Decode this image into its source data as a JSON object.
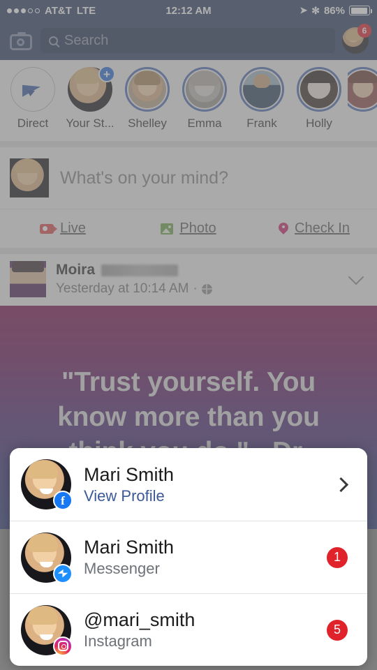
{
  "status_bar": {
    "carrier": "AT&T",
    "network": "LTE",
    "time": "12:12 AM",
    "battery_percent": "86%",
    "signal_dots_filled": 3,
    "signal_dots_total": 5,
    "location_icon": "location-arrow-icon",
    "bluetooth_icon": "bluetooth-icon"
  },
  "nav": {
    "camera_icon": "camera-icon",
    "search_placeholder": "Search",
    "search_value": "",
    "search_icon": "search-icon",
    "profile_badge_count": "6"
  },
  "stories": {
    "items": [
      {
        "label": "Direct",
        "icon": "paper-plane-icon",
        "ring": "plain",
        "has_plus": false
      },
      {
        "label": "Your St...",
        "icon": "",
        "ring": "none",
        "has_plus": true,
        "plus_label": "+"
      },
      {
        "label": "Shelley",
        "icon": "",
        "ring": "blue",
        "has_plus": false
      },
      {
        "label": "Emma",
        "icon": "",
        "ring": "blue",
        "has_plus": false
      },
      {
        "label": "Frank",
        "icon": "",
        "ring": "blue",
        "has_plus": false
      },
      {
        "label": "Holly",
        "icon": "",
        "ring": "blue",
        "has_plus": false
      },
      {
        "label": "",
        "icon": "",
        "ring": "blue",
        "has_plus": false
      }
    ]
  },
  "composer": {
    "placeholder": "What's on your mind?",
    "actions": [
      {
        "label": "Live",
        "icon": "video-camera-icon",
        "color": "#d94a4a"
      },
      {
        "label": "Photo",
        "icon": "photo-icon",
        "color": "#6ea24a"
      },
      {
        "label": "Check In",
        "icon": "location-pin-icon",
        "color": "#c9246b"
      }
    ]
  },
  "post": {
    "author": "Moira",
    "author_redacted": true,
    "timestamp": "Yesterday at 10:14 AM",
    "separator": "·",
    "privacy_icon": "globe-icon",
    "menu_icon": "chevron-down-icon",
    "quote": "\"Trust yourself. You know more than you think you do.\" ~Dr.",
    "gradient_from": "#7a0f4e",
    "gradient_to": "#2e3a7a"
  },
  "account_sheet": {
    "rows": [
      {
        "title": "Mari Smith",
        "subtitle": "View Profile",
        "subtitle_style": "link",
        "app_badge_icon": "facebook-badge-icon",
        "trailing": "chevron-right-icon",
        "trailing_icon": "chevron-right-icon",
        "count": ""
      },
      {
        "title": "Mari Smith",
        "subtitle": "Messenger",
        "subtitle_style": "muted",
        "app_badge_icon": "messenger-badge-icon",
        "trailing": "count",
        "trailing_icon": "",
        "count": "1"
      },
      {
        "title": "@mari_smith",
        "subtitle": "Instagram",
        "subtitle_style": "muted",
        "app_badge_icon": "instagram-badge-icon",
        "trailing": "count",
        "trailing_icon": "",
        "count": "5"
      }
    ],
    "badge_color": "#e0222b",
    "facebook_letter": "f"
  }
}
